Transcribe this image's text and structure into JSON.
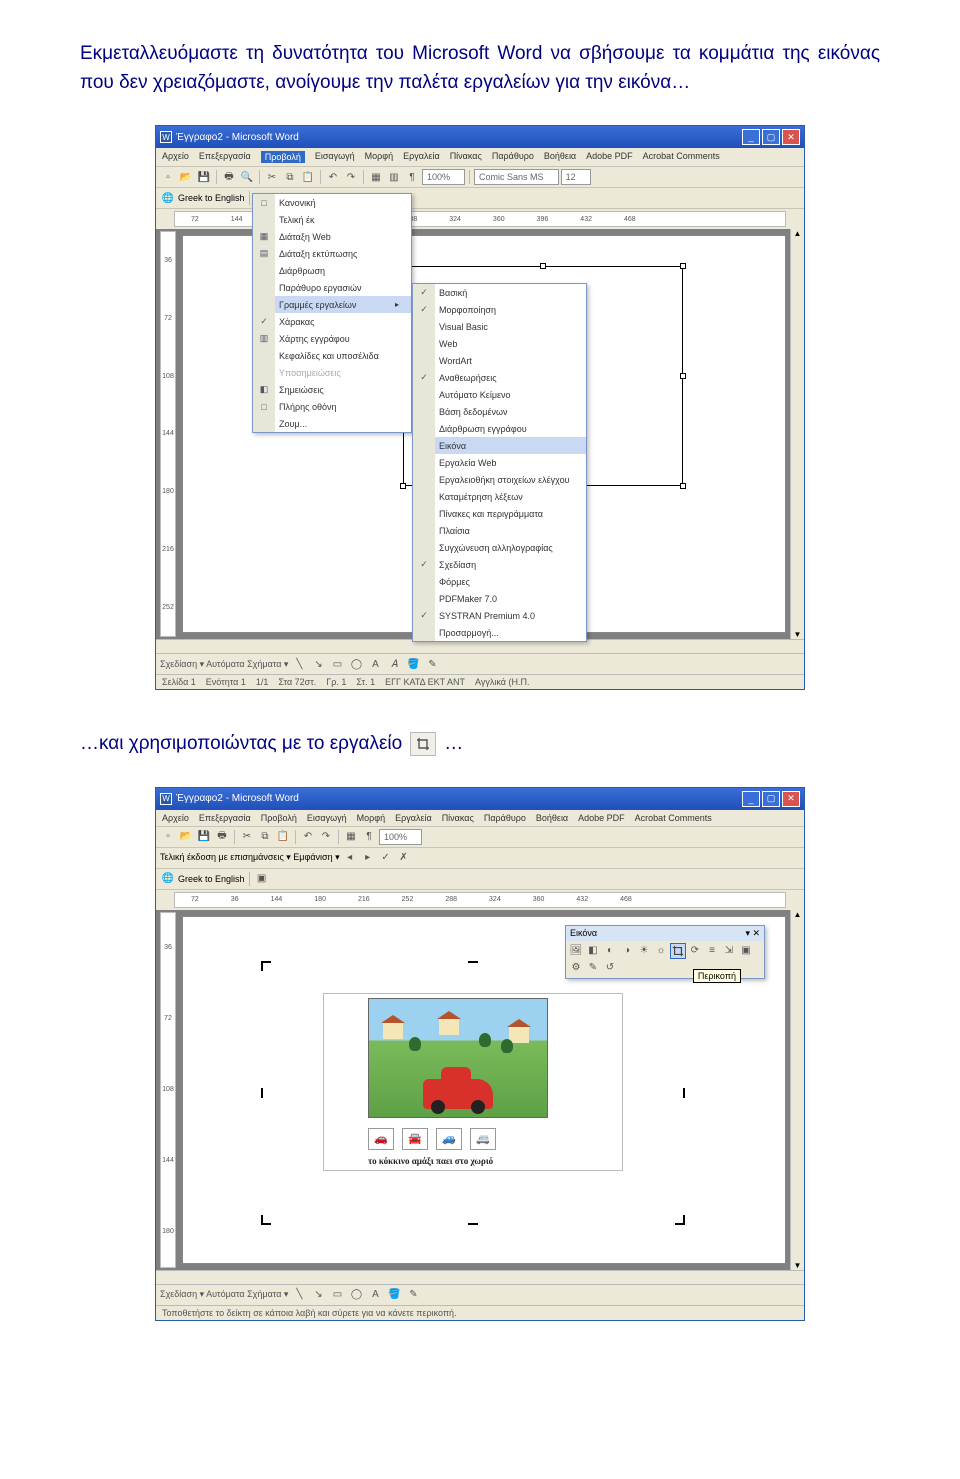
{
  "para1": "Εκμεταλλευόμαστε τη δυνατότητα του Microsoft Word να σβήσουμε τα κομμάτια της εικόνας που δεν χρειαζόμαστε, ανοίγουμε την παλέτα εργαλείων για την εικόνα…",
  "para2a": "…και χρησιμοποιώντας με το εργαλείο",
  "para2b": "…",
  "window": {
    "title": "Έγγραφο2 - Microsoft Word",
    "menus": [
      "Αρχείο",
      "Επεξεργασία",
      "Προβολή",
      "Εισαγωγή",
      "Μορφή",
      "Εργαλεία",
      "Πίνακας",
      "Παράθυρο",
      "Βοήθεια",
      "Adobe PDF",
      "Acrobat Comments"
    ],
    "active_menu_index": 2,
    "toolbar2": {
      "font": "Comic Sans MS",
      "size": "12",
      "zoom": "100%"
    },
    "translate_btn": "Greek to English",
    "ruler_h": [
      "72",
      "36",
      "",
      "",
      "144",
      "180",
      "216",
      "252",
      "288",
      "324",
      "360",
      "396",
      "432",
      "468"
    ],
    "ruler_v": [
      "36",
      "72",
      "108",
      "144",
      "180",
      "216",
      "252"
    ],
    "view_menu": [
      {
        "label": "Κανονική",
        "icon": "□"
      },
      {
        "label": "Τελική έκ",
        "sep": false
      },
      {
        "label": "Διάταξη Web",
        "icon": "▦"
      },
      {
        "label": "Διάταξη εκτύπωσης",
        "icon": "▤"
      },
      {
        "label": "Διάρθρωση",
        "icon": ""
      },
      {
        "label": "Παράθυρο εργασιών",
        "icon": ""
      },
      {
        "label": "Γραμμές εργαλείων",
        "icon": "",
        "hl": true,
        "arrow": true
      },
      {
        "label": "Χάρακας",
        "icon": "✓"
      },
      {
        "label": "Χάρτης εγγράφου",
        "icon": "▥"
      },
      {
        "label": "Κεφαλίδες και υποσέλιδα",
        "icon": ""
      },
      {
        "label": "Υποσημειώσεις",
        "icon": "",
        "dim": true
      },
      {
        "label": "Σημειώσεις",
        "icon": "◧"
      },
      {
        "label": "Πλήρης οθόνη",
        "icon": "□"
      },
      {
        "label": "Ζουμ...",
        "icon": ""
      }
    ],
    "toolbars_submenu": [
      {
        "label": "Βασική",
        "icon": "✓"
      },
      {
        "label": "Μορφοποίηση",
        "icon": "✓"
      },
      {
        "label": "Visual Basic"
      },
      {
        "label": "Web"
      },
      {
        "label": "WordArt"
      },
      {
        "label": "Αναθεωρήσεις",
        "icon": "✓"
      },
      {
        "label": "Αυτόματο Κείμενο"
      },
      {
        "label": "Βάση δεδομένων"
      },
      {
        "label": "Διάρθρωση εγγράφου"
      },
      {
        "label": "Εικόνα",
        "hl": true
      },
      {
        "label": "Εργαλεία Web"
      },
      {
        "label": "Εργαλειοθήκη στοιχείων ελέγχου"
      },
      {
        "label": "Καταμέτρηση λέξεων"
      },
      {
        "label": "Πίνακες και περιγράμματα"
      },
      {
        "label": "Πλαίσια"
      },
      {
        "label": "Συγχώνευση αλληλογραφίας"
      },
      {
        "label": "Σχεδίαση",
        "icon": "✓"
      },
      {
        "label": "Φόρμες"
      },
      {
        "label": "PDFMaker 7.0"
      },
      {
        "label": "SYSTRAN Premium 4.0",
        "icon": "✓"
      },
      {
        "label": "Προσαρμογή..."
      }
    ],
    "drawbar": "Σχεδίαση ▾   Αυτόματα Σχήματα ▾",
    "status": [
      "Σελίδα 1",
      "Ενότητα 1",
      "1/1",
      "Στα 72στ.",
      "Γρ. 1",
      "Στ. 1",
      "ΕΓΓ  ΚΑΤΔ  ΕΚΤ  ΑΝΤ",
      "Αγγλικά (Η.Π."
    ]
  },
  "window2": {
    "title": "Έγγραφο2 - Microsoft Word",
    "revision_bar": "Τελική έκδοση με επισημάνσεις   ▾  Εμφάνιση ▾",
    "pic_toolbar_title": "Εικόνα",
    "tooltip": "Περικοπή",
    "caption_in_page": "το κόκκινο αμάξι παει στο χωριό",
    "footer_hint": "Τοποθετήστε το δείκτη σε κάποια λαβή και σύρετε για να κάνετε περικοπή."
  }
}
